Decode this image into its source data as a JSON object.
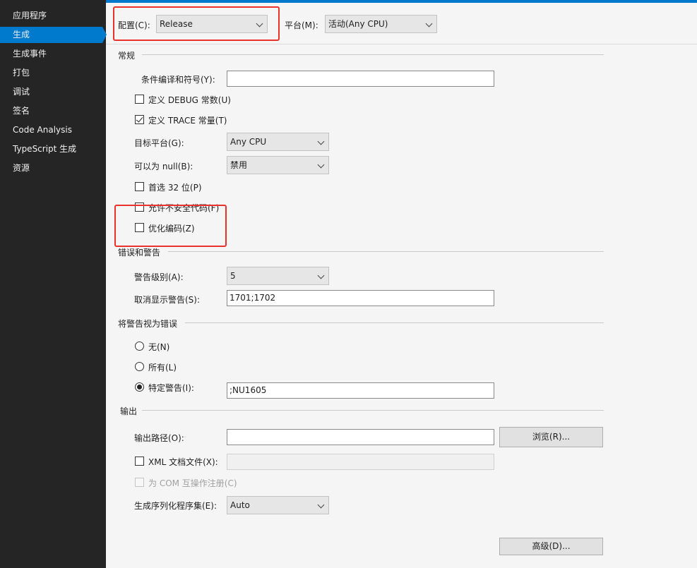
{
  "sidebar": {
    "items": [
      {
        "label": "应用程序"
      },
      {
        "label": "生成"
      },
      {
        "label": "生成事件"
      },
      {
        "label": "打包"
      },
      {
        "label": "调试"
      },
      {
        "label": "签名"
      },
      {
        "label": "Code Analysis"
      },
      {
        "label": "TypeScript 生成"
      },
      {
        "label": "资源"
      }
    ],
    "active_index": 1
  },
  "header": {
    "config_label": "配置(C):",
    "config_value": "Release",
    "platform_label": "平台(M):",
    "platform_value": "活动(Any CPU)"
  },
  "general": {
    "title": "常规",
    "cond_symbols_label": "条件编译和符号(Y):",
    "cond_symbols_value": "",
    "define_debug_label": "定义 DEBUG 常数(U)",
    "define_debug_checked": false,
    "define_trace_label": "定义 TRACE 常量(T)",
    "define_trace_checked": true,
    "target_platform_label": "目标平台(G):",
    "target_platform_value": "Any CPU",
    "nullable_label": "可以为 null(B):",
    "nullable_value": "禁用",
    "prefer32_label": "首选 32 位(P)",
    "prefer32_checked": false,
    "unsafe_label": "允许不安全代码(F)",
    "unsafe_checked": false,
    "optimize_label": "优化编码(Z)",
    "optimize_checked": false
  },
  "errors": {
    "title": "错误和警告",
    "warning_level_label": "警告级别(A):",
    "warning_level_value": "5",
    "suppress_label": "取消显示警告(S):",
    "suppress_value": "1701;1702"
  },
  "treat_warnings": {
    "title": "将警告视为错误",
    "none_label": "无(N)",
    "all_label": "所有(L)",
    "specific_label": "特定警告(I):",
    "specific_value": ";NU1605",
    "selected": "specific"
  },
  "output": {
    "title": "输出",
    "path_label": "输出路径(O):",
    "path_value": "",
    "browse_label": "浏览(R)...",
    "xml_doc_label": "XML 文档文件(X):",
    "xml_doc_checked": false,
    "xml_doc_value": "",
    "com_interop_label": "为 COM 互操作注册(C)",
    "com_interop_checked": false,
    "serialization_label": "生成序列化程序集(E):",
    "serialization_value": "Auto",
    "advanced_label": "高级(D)..."
  },
  "colors": {
    "sidebar_bg": "#252526",
    "accent": "#007acc",
    "highlight": "#e8322a",
    "page_bg": "#f5f5f5"
  }
}
